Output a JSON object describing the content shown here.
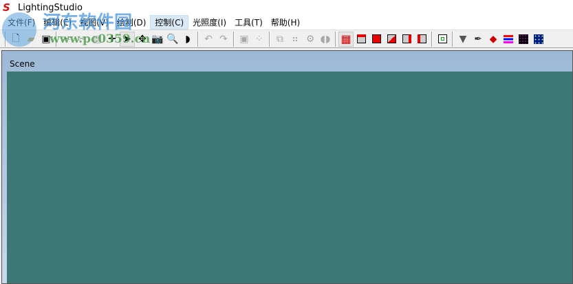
{
  "window": {
    "title": "LightingStudio"
  },
  "menu": [
    {
      "label": "文件(F)"
    },
    {
      "label": "编辑(E)"
    },
    {
      "label": "视图(V)"
    },
    {
      "label": "绘制(D)"
    },
    {
      "label": "控制(C)"
    },
    {
      "label": "光照度(I)"
    },
    {
      "label": "工具(T)"
    },
    {
      "label": "帮助(H)"
    }
  ],
  "child": {
    "title": "Scene"
  },
  "watermark": {
    "name": "河东软件园",
    "url": "www.pc0359.cn"
  },
  "colors": {
    "scene_bg": "#3d7876",
    "accent_red": "#ff0000"
  }
}
